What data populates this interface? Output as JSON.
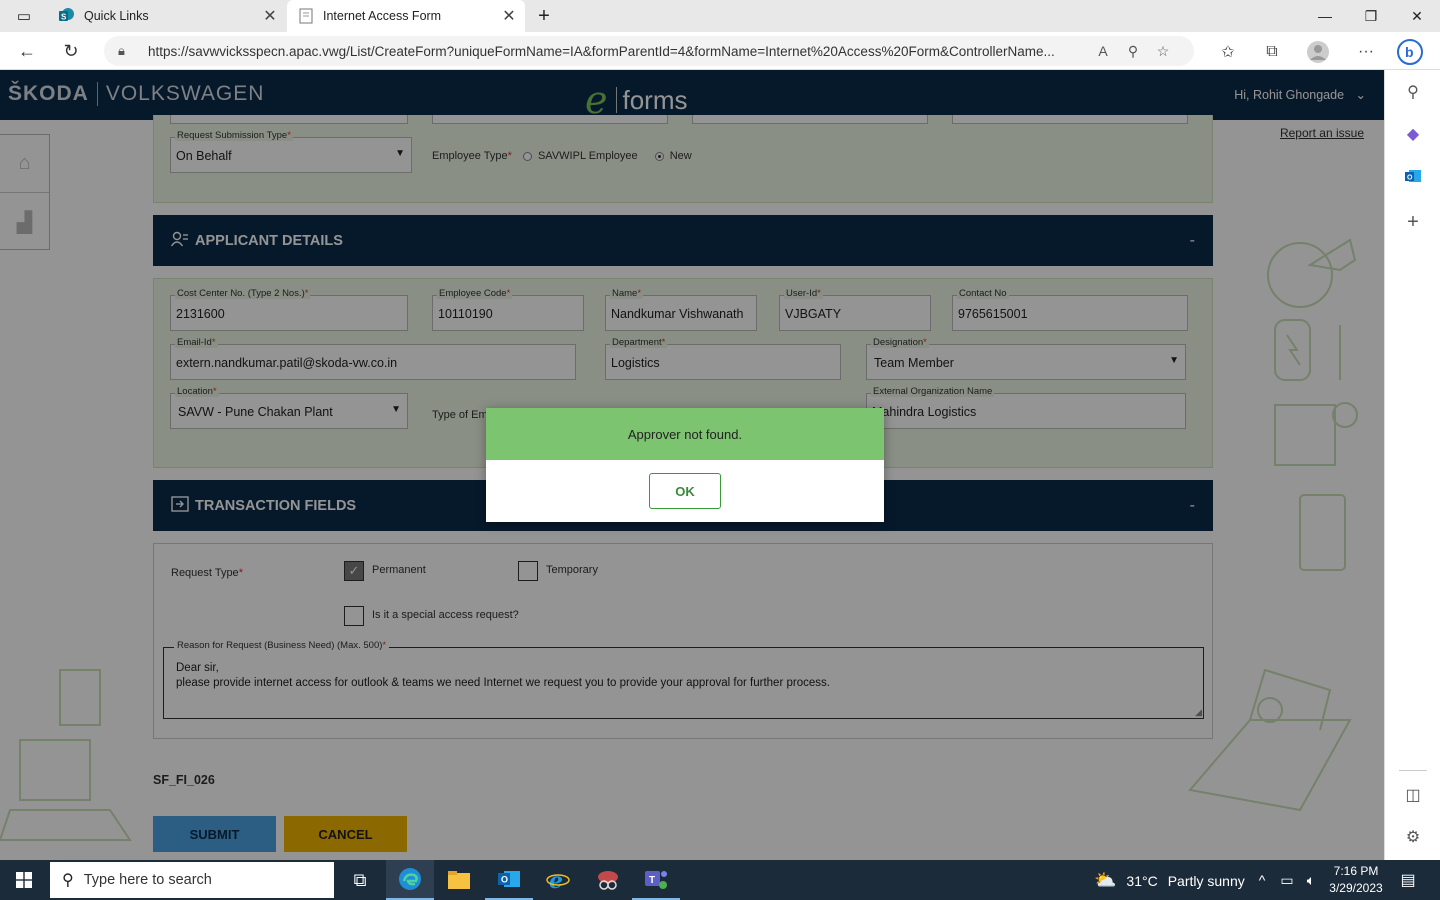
{
  "browser": {
    "tabs": [
      {
        "title": "Quick Links",
        "active": false
      },
      {
        "title": "Internet Access Form",
        "active": true
      }
    ],
    "url": "https://savwvicksspecn.apac.vwg/List/CreateForm?uniqueFormName=IA&formParentId=4&formName=Internet%20Access%20Form&ControllerName..."
  },
  "header": {
    "brand_left": "ŠKODA",
    "brand_right": "VOLKSWAGEN",
    "app_name": "forms",
    "greeting": "Hi, Rohit Ghongade",
    "report_link": "Report an issue"
  },
  "request": {
    "submission_type_label": "Request Submission Type",
    "submission_type_value": "On Behalf",
    "employee_type_label": "Employee Type",
    "employee_type_options": [
      "SAVWIPL Employee",
      "New"
    ],
    "employee_type_selected": "New"
  },
  "applicant": {
    "title": "APPLICANT DETAILS",
    "collapse": "-",
    "fields": {
      "cost_center_label": "Cost Center No. (Type 2 Nos.)",
      "cost_center_value": "2131600",
      "employee_code_label": "Employee Code",
      "employee_code_value": "10110190",
      "name_label": "Name",
      "name_value": "Nandkumar Vishwanath",
      "user_id_label": "User-Id",
      "user_id_value": "VJBGATY",
      "contact_label": "Contact No",
      "contact_value": "9765615001",
      "email_label": "Email-Id",
      "email_value": "extern.nandkumar.patil@skoda-vw.co.in",
      "department_label": "Department",
      "department_value": "Logistics",
      "designation_label": "Designation",
      "designation_value": "Team Member",
      "location_label": "Location",
      "location_value": "SAVW - Pune Chakan Plant",
      "type_label": "Type of Em",
      "ext_org_label": "External Organization Name",
      "ext_org_value": "Mahindra Logistics"
    }
  },
  "transaction": {
    "title": "TRANSACTION FIELDS",
    "collapse": "-",
    "request_type_label": "Request Type",
    "permanent_label": "Permanent",
    "permanent_checked": true,
    "temporary_label": "Temporary",
    "temporary_checked": false,
    "special_label": "Is it a special access request?",
    "reason_label": "Reason for Request (Business Need) (Max. 500)",
    "reason_line1": "Dear sir,",
    "reason_line2": "please provide internet access for outlook & teams we need Internet we request you to provide your approval for further process."
  },
  "footer": {
    "form_code": "SF_FI_026",
    "submit": "SUBMIT",
    "cancel": "CANCEL"
  },
  "modal": {
    "message": "Approver not found.",
    "ok": "OK"
  },
  "taskbar": {
    "search_placeholder": "Type here to search",
    "temperature": "31°C",
    "weather": "Partly sunny",
    "time": "7:16 PM",
    "date": "3/29/2023"
  },
  "colors": {
    "header": "#0c2b4a",
    "section_bg": "#eef6e6",
    "modal_head": "#7cc470",
    "submit": "#4aa3e0",
    "cancel": "#f0b400"
  }
}
